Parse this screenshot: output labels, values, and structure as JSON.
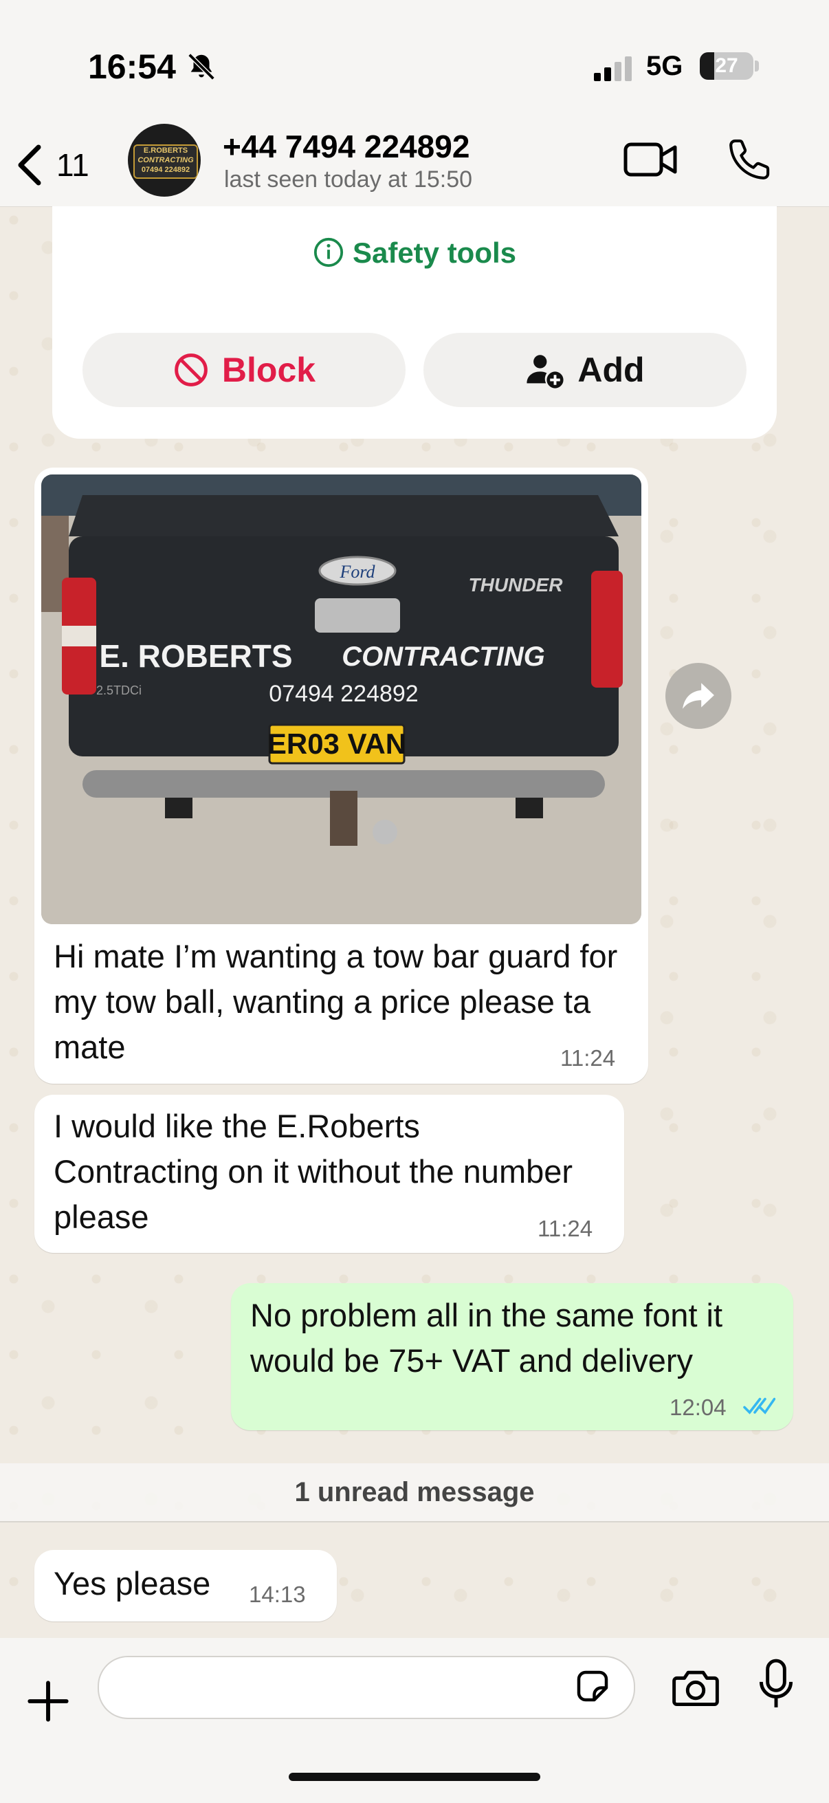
{
  "status_bar": {
    "time": "16:54",
    "network": "5G",
    "battery": "27",
    "battery_level": 0.27
  },
  "header": {
    "back_count": "11",
    "contact_name": "+44 7494 224892",
    "last_seen": "last seen today at 15:50",
    "avatar_text": [
      "E.ROBERTS",
      "CONTRACTING",
      "07494 224892"
    ]
  },
  "safety": {
    "title": "Safety tools",
    "block_label": "Block",
    "add_label": "Add"
  },
  "photo": {
    "plate": "ER03 VAN",
    "brand": "Ford",
    "model": "THUNDER",
    "decal_name": "E. ROBERTS",
    "decal_business": "CONTRACTING",
    "decal_phone": "07494 224892",
    "badge": "2.5TDCi"
  },
  "messages": [
    {
      "text": "Hi mate I’m wanting a tow bar guard for my tow ball, wanting a price please ta mate",
      "time": "11:24"
    },
    {
      "text": "I would like the E.Roberts Contracting on it without the number please",
      "time": "11:24"
    },
    {
      "text": "No problem all in the same font it would be 75+ VAT and delivery",
      "time": "12:04",
      "status": "read"
    },
    {
      "text": "Yes please",
      "time": "14:13"
    }
  ],
  "unread_banner": "1 unread message",
  "colors": {
    "green": "#1a8a4c",
    "red": "#e11d48",
    "outgoing": "#d9fdd3",
    "tick": "#34b7f1"
  }
}
